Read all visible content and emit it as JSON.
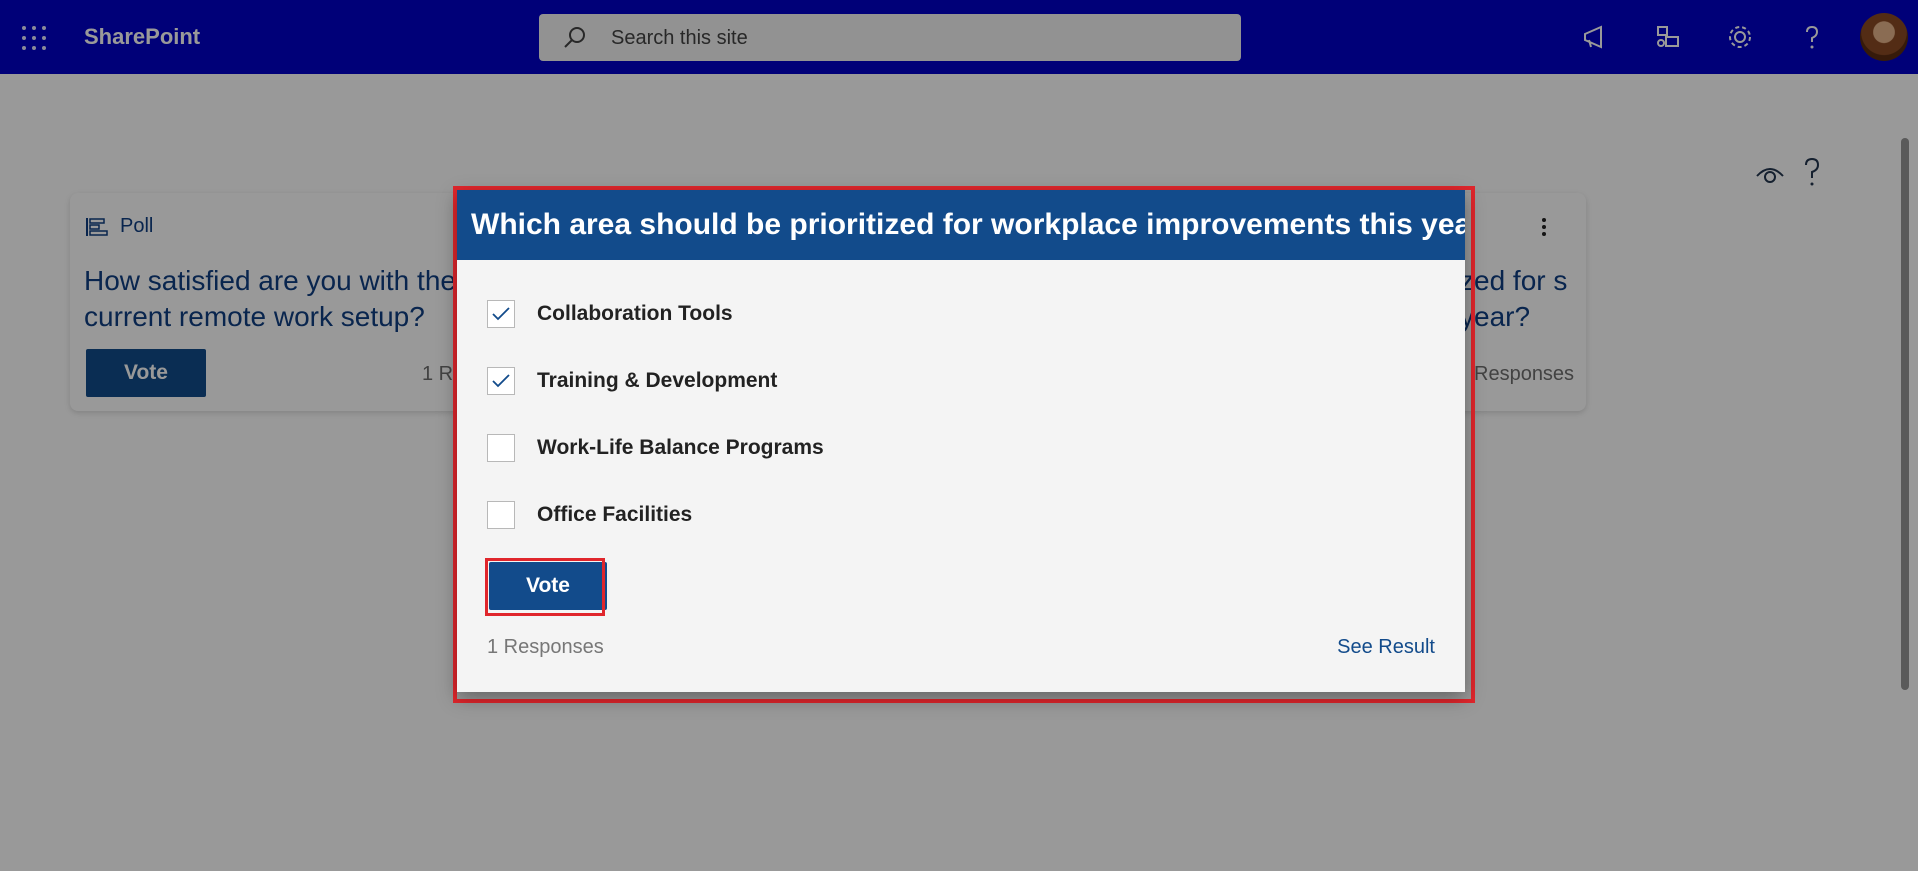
{
  "header": {
    "app_name": "SharePoint",
    "search_placeholder": "Search this site"
  },
  "page": {
    "card": {
      "type_label": "Poll",
      "left_question": "How satisfied are you with the current remote work setup?",
      "right_question_fragment": "zed for s year?",
      "vote_label": "Vote",
      "left_responses_fragment": "1 R",
      "right_responses_fragment": "Responses"
    }
  },
  "dialog": {
    "title": "Which area should be prioritized for workplace improvements this year?",
    "options": [
      {
        "label": "Collaboration Tools",
        "checked": true
      },
      {
        "label": "Training & Development",
        "checked": true
      },
      {
        "label": "Work-Life Balance Programs",
        "checked": false
      },
      {
        "label": "Office Facilities",
        "checked": false
      }
    ],
    "vote_label": "Vote",
    "responses": "1 Responses",
    "see_result": "See Result"
  },
  "colors": {
    "suite_bar": "#0000c8",
    "brand_blue": "#124b8b",
    "highlight_red": "#e0262c"
  },
  "icons": [
    "waffle-icon",
    "search-icon",
    "megaphone-icon",
    "feedback-icon",
    "gear-icon",
    "help-icon",
    "eye-icon",
    "help-icon",
    "poll-icon",
    "more-vertical-icon",
    "checkmark-icon"
  ]
}
